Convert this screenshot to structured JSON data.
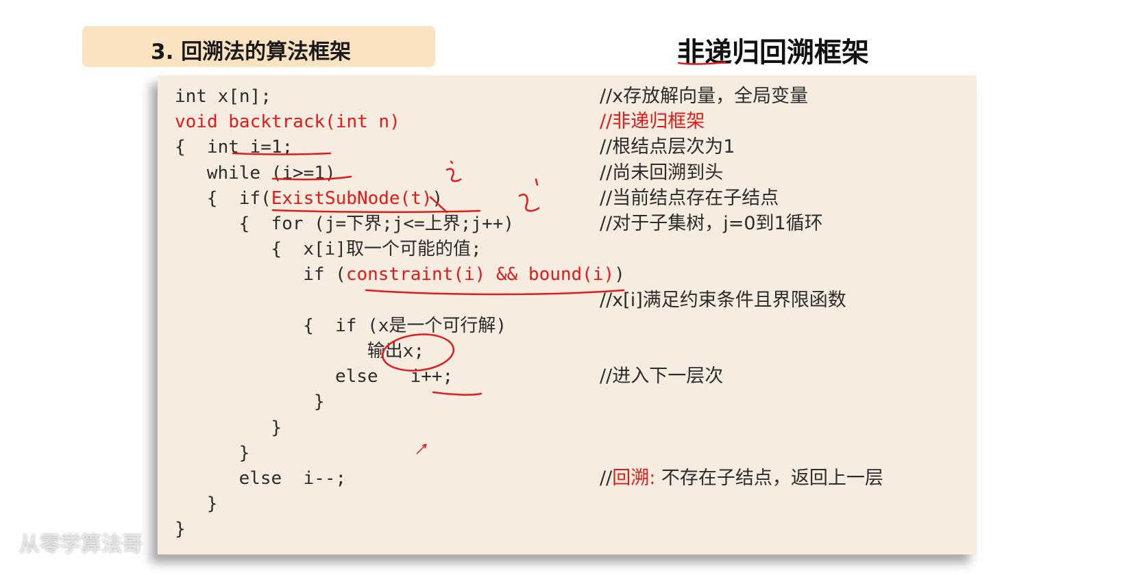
{
  "section_tab": {
    "title": "3. 回溯法的算法框架"
  },
  "heading": "非递归回溯框架",
  "code": [
    {
      "indent": 0,
      "text": "int x[n];",
      "color": "normal",
      "comment": "//x存放解向量，全局变量",
      "comment_color": "normal"
    },
    {
      "indent": 0,
      "text": "void backtrack(int n)",
      "color": "red",
      "comment": "//非递归框架",
      "comment_color": "red"
    },
    {
      "indent": 0,
      "text": "{  int i=1;",
      "color": "normal",
      "comment": "//根结点层次为1",
      "comment_color": "normal"
    },
    {
      "indent": 3,
      "text": "while (i>=1)",
      "color": "normal",
      "comment": "//尚未回溯到头",
      "comment_color": "normal"
    },
    {
      "indent": 3,
      "prefix": "{  if(",
      "red": "ExistSubNode(t)",
      "suffix": ")",
      "comment": "//当前结点存在子结点",
      "comment_color": "normal"
    },
    {
      "indent": 6,
      "text": "{  for (j=下界;j<=上界;j++)",
      "color": "normal",
      "comment": "//对于子集树，j=0到1循环",
      "comment_color": "normal"
    },
    {
      "indent": 9,
      "text": "{  x[i]取一个可能的值;",
      "color": "normal",
      "comment": "",
      "comment_color": "normal"
    },
    {
      "indent": 12,
      "prefix": "if (",
      "red": "constraint(i) && bound(i)",
      "suffix": ")",
      "comment": "",
      "comment_color": "normal"
    },
    {
      "indent": 0,
      "text": "",
      "color": "normal",
      "comment": "//x[i]满足约束条件且界限函数",
      "comment_color": "normal"
    },
    {
      "indent": 12,
      "text": "{  if (x是一个可行解)",
      "color": "normal",
      "comment": "",
      "comment_color": "normal"
    },
    {
      "indent": 18,
      "text": "输出x;",
      "color": "normal",
      "comment": "",
      "comment_color": "normal"
    },
    {
      "indent": 15,
      "text": "else   i++;",
      "color": "normal",
      "comment": "//进入下一层次",
      "comment_color": "normal"
    },
    {
      "indent": 12,
      "text": " }",
      "color": "normal",
      "comment": "",
      "comment_color": "normal"
    },
    {
      "indent": 9,
      "text": "}",
      "color": "normal",
      "comment": "",
      "comment_color": "normal"
    },
    {
      "indent": 6,
      "text": "}",
      "color": "normal",
      "comment": "",
      "comment_color": "normal"
    },
    {
      "indent": 6,
      "text": "else  i--;",
      "color": "normal",
      "comment_parts": [
        "//",
        "回溯:",
        " 不存在子结点，返回上一层"
      ],
      "comment_color": "mixed"
    },
    {
      "indent": 3,
      "text": "}",
      "color": "normal",
      "comment": "",
      "comment_color": "normal"
    },
    {
      "indent": 0,
      "text": "}",
      "color": "normal",
      "comment": "",
      "comment_color": "normal"
    }
  ],
  "watermark": "从零学算法哥",
  "colors": {
    "accent_red": "#e21a1a",
    "tab_bg": "#fbe3c1",
    "panel_bg": "#f7ece0",
    "text": "#2b2b2b"
  },
  "icons": [
    "mouse-cursor-icon"
  ]
}
